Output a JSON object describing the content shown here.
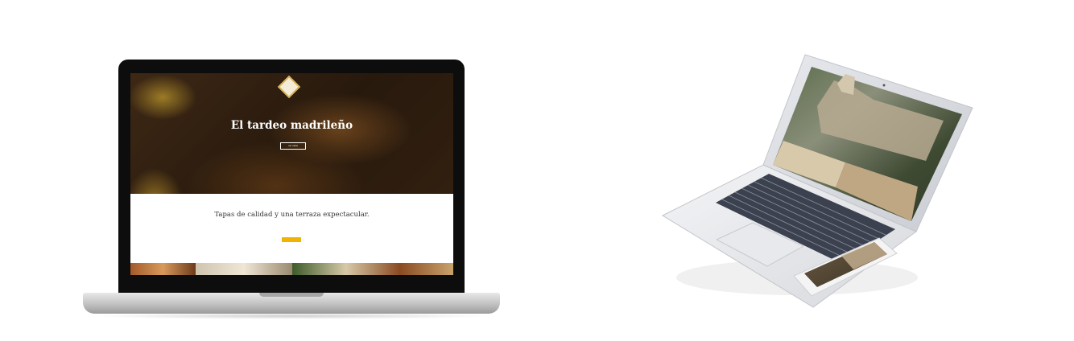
{
  "macbook_site": {
    "hero_title": "El tardeo madrileño",
    "hero_subtitle": "",
    "hero_button": "ver carta",
    "tagline_title": "Tapas de calidad y una terraza expectacular.",
    "tagline_text_1": "",
    "tagline_text_2": "",
    "cta_button": ""
  },
  "chromebook_site": {
    "hero_title": "",
    "brand_text": ""
  },
  "colors": {
    "accent_gold": "#d9b24e",
    "cta_yellow": "#f0b400",
    "beige_panel": "#c9b393"
  }
}
